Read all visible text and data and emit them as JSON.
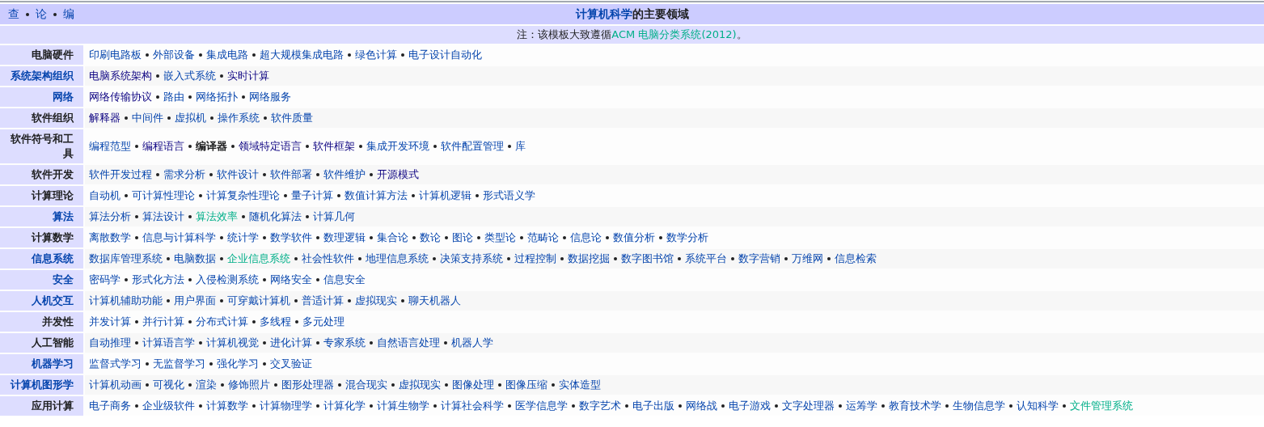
{
  "navbar": [
    {
      "label": "查"
    },
    {
      "label": "论"
    },
    {
      "label": "编"
    }
  ],
  "title": {
    "link": "计算机科学",
    "rest": "的主要领域"
  },
  "note": {
    "before": "注：该模板大致遵循",
    "link": "ACM 电脑分类系统(2012)",
    "after": "。"
  },
  "groups": [
    {
      "label": "电脑硬件",
      "linked": false,
      "items": [
        {
          "text": "印刷电路板",
          "kind": "link"
        },
        {
          "text": "外部设备",
          "kind": "link"
        },
        {
          "text": "集成电路",
          "kind": "link"
        },
        {
          "text": "超大规模集成电路",
          "kind": "link"
        },
        {
          "text": "绿色计算",
          "kind": "link"
        },
        {
          "text": "电子设计自动化",
          "kind": "link"
        }
      ]
    },
    {
      "label": "系统架构组织",
      "linked": true,
      "items": [
        {
          "text": "电脑系统架构",
          "kind": "visited"
        },
        {
          "text": "嵌入式系统",
          "kind": "link"
        },
        {
          "text": "实时计算",
          "kind": "visited"
        }
      ]
    },
    {
      "label": "网络",
      "linked": true,
      "items": [
        {
          "text": "网络传输协议",
          "kind": "visited"
        },
        {
          "text": "路由",
          "kind": "link"
        },
        {
          "text": "网络拓扑",
          "kind": "link"
        },
        {
          "text": "网络服务",
          "kind": "link"
        }
      ]
    },
    {
      "label": "软件组织",
      "linked": false,
      "items": [
        {
          "text": "解释器",
          "kind": "visited"
        },
        {
          "text": "中间件",
          "kind": "link"
        },
        {
          "text": "虚拟机",
          "kind": "link"
        },
        {
          "text": "操作系统",
          "kind": "link"
        },
        {
          "text": "软件质量",
          "kind": "link"
        }
      ]
    },
    {
      "label": "软件符号和工具",
      "linked": false,
      "items": [
        {
          "text": "编程范型",
          "kind": "link"
        },
        {
          "text": "编程语言",
          "kind": "visited"
        },
        {
          "text": "编译器",
          "kind": "bold"
        },
        {
          "text": "领域特定语言",
          "kind": "visited"
        },
        {
          "text": "软件框架",
          "kind": "visited"
        },
        {
          "text": "集成开发环境",
          "kind": "link"
        },
        {
          "text": "软件配置管理",
          "kind": "link"
        },
        {
          "text": "库",
          "kind": "link"
        }
      ]
    },
    {
      "label": "软件开发",
      "linked": false,
      "items": [
        {
          "text": "软件开发过程",
          "kind": "link"
        },
        {
          "text": "需求分析",
          "kind": "link"
        },
        {
          "text": "软件设计",
          "kind": "link"
        },
        {
          "text": "软件部署",
          "kind": "link"
        },
        {
          "text": "软件维护",
          "kind": "link"
        },
        {
          "text": "开源模式",
          "kind": "visited"
        }
      ]
    },
    {
      "label": "计算理论",
      "linked": false,
      "items": [
        {
          "text": "自动机",
          "kind": "link"
        },
        {
          "text": "可计算性理论",
          "kind": "link"
        },
        {
          "text": "计算复杂性理论",
          "kind": "link"
        },
        {
          "text": "量子计算",
          "kind": "link"
        },
        {
          "text": "数值计算方法",
          "kind": "link"
        },
        {
          "text": "计算机逻辑",
          "kind": "link"
        },
        {
          "text": "形式语义学",
          "kind": "link"
        }
      ]
    },
    {
      "label": "算法",
      "linked": true,
      "items": [
        {
          "text": "算法分析",
          "kind": "link"
        },
        {
          "text": "算法设计",
          "kind": "link"
        },
        {
          "text": "算法效率",
          "kind": "ext"
        },
        {
          "text": "随机化算法",
          "kind": "link"
        },
        {
          "text": "计算几何",
          "kind": "link"
        }
      ]
    },
    {
      "label": "计算数学",
      "linked": false,
      "items": [
        {
          "text": "离散数学",
          "kind": "link"
        },
        {
          "text": "信息与计算科学",
          "kind": "link"
        },
        {
          "text": "统计学",
          "kind": "link"
        },
        {
          "text": "数学软件",
          "kind": "link"
        },
        {
          "text": "数理逻辑",
          "kind": "link"
        },
        {
          "text": "集合论",
          "kind": "link"
        },
        {
          "text": "数论",
          "kind": "link"
        },
        {
          "text": "图论",
          "kind": "link"
        },
        {
          "text": "类型论",
          "kind": "link"
        },
        {
          "text": "范畴论",
          "kind": "link"
        },
        {
          "text": "信息论",
          "kind": "link"
        },
        {
          "text": "数值分析",
          "kind": "link"
        },
        {
          "text": "数学分析",
          "kind": "link"
        }
      ]
    },
    {
      "label": "信息系统",
      "linked": true,
      "items": [
        {
          "text": "数据库管理系统",
          "kind": "link"
        },
        {
          "text": "电脑数据",
          "kind": "link"
        },
        {
          "text": "企业信息系统",
          "kind": "ext"
        },
        {
          "text": "社会性软件",
          "kind": "link"
        },
        {
          "text": "地理信息系统",
          "kind": "link"
        },
        {
          "text": "决策支持系统",
          "kind": "link"
        },
        {
          "text": "过程控制",
          "kind": "link"
        },
        {
          "text": "数据挖掘",
          "kind": "link"
        },
        {
          "text": "数字图书馆",
          "kind": "link"
        },
        {
          "text": "系统平台",
          "kind": "link"
        },
        {
          "text": "数字营销",
          "kind": "link"
        },
        {
          "text": "万维网",
          "kind": "link"
        },
        {
          "text": "信息检索",
          "kind": "link"
        }
      ]
    },
    {
      "label": "安全",
      "linked": true,
      "items": [
        {
          "text": "密码学",
          "kind": "link"
        },
        {
          "text": "形式化方法",
          "kind": "link"
        },
        {
          "text": "入侵检测系统",
          "kind": "link"
        },
        {
          "text": "网络安全",
          "kind": "link"
        },
        {
          "text": "信息安全",
          "kind": "link"
        }
      ]
    },
    {
      "label": "人机交互",
      "linked": true,
      "items": [
        {
          "text": "计算机辅助功能",
          "kind": "link"
        },
        {
          "text": "用户界面",
          "kind": "link"
        },
        {
          "text": "可穿戴计算机",
          "kind": "link"
        },
        {
          "text": "普适计算",
          "kind": "link"
        },
        {
          "text": "虚拟现实",
          "kind": "link"
        },
        {
          "text": "聊天机器人",
          "kind": "link"
        }
      ]
    },
    {
      "label": "并发性",
      "linked": false,
      "items": [
        {
          "text": "并发计算",
          "kind": "link"
        },
        {
          "text": "并行计算",
          "kind": "link"
        },
        {
          "text": "分布式计算",
          "kind": "link"
        },
        {
          "text": "多线程",
          "kind": "link"
        },
        {
          "text": "多元处理",
          "kind": "link"
        }
      ]
    },
    {
      "label": "人工智能",
      "linked": false,
      "items": [
        {
          "text": "自动推理",
          "kind": "link"
        },
        {
          "text": "计算语言学",
          "kind": "link"
        },
        {
          "text": "计算机视觉",
          "kind": "link"
        },
        {
          "text": "进化计算",
          "kind": "link"
        },
        {
          "text": "专家系统",
          "kind": "link"
        },
        {
          "text": "自然语言处理",
          "kind": "link"
        },
        {
          "text": "机器人学",
          "kind": "link"
        }
      ]
    },
    {
      "label": "机器学习",
      "linked": true,
      "items": [
        {
          "text": "监督式学习",
          "kind": "link"
        },
        {
          "text": "无监督学习",
          "kind": "link"
        },
        {
          "text": "强化学习",
          "kind": "link"
        },
        {
          "text": "交叉验证",
          "kind": "link"
        }
      ]
    },
    {
      "label": "计算机图形学",
      "linked": true,
      "items": [
        {
          "text": "计算机动画",
          "kind": "link"
        },
        {
          "text": "可视化",
          "kind": "link"
        },
        {
          "text": "渲染",
          "kind": "link"
        },
        {
          "text": "修饰照片",
          "kind": "link"
        },
        {
          "text": "图形处理器",
          "kind": "link"
        },
        {
          "text": "混合现实",
          "kind": "link"
        },
        {
          "text": "虚拟现实",
          "kind": "link"
        },
        {
          "text": "图像处理",
          "kind": "link"
        },
        {
          "text": "图像压缩",
          "kind": "link"
        },
        {
          "text": "实体造型",
          "kind": "link"
        }
      ]
    },
    {
      "label": "应用计算",
      "linked": false,
      "items": [
        {
          "text": "电子商务",
          "kind": "link"
        },
        {
          "text": "企业级软件",
          "kind": "link"
        },
        {
          "text": "计算数学",
          "kind": "link"
        },
        {
          "text": "计算物理学",
          "kind": "link"
        },
        {
          "text": "计算化学",
          "kind": "link"
        },
        {
          "text": "计算生物学",
          "kind": "link"
        },
        {
          "text": "计算社会科学",
          "kind": "link"
        },
        {
          "text": "医学信息学",
          "kind": "link"
        },
        {
          "text": "数字艺术",
          "kind": "link"
        },
        {
          "text": "电子出版",
          "kind": "link"
        },
        {
          "text": "网络战",
          "kind": "link"
        },
        {
          "text": "电子游戏",
          "kind": "link"
        },
        {
          "text": "文字处理器",
          "kind": "link"
        },
        {
          "text": "运筹学",
          "kind": "link"
        },
        {
          "text": "教育技术学",
          "kind": "link"
        },
        {
          "text": "生物信息学",
          "kind": "link"
        },
        {
          "text": "认知科学",
          "kind": "link"
        },
        {
          "text": "文件管理系统",
          "kind": "ext"
        }
      ]
    }
  ]
}
